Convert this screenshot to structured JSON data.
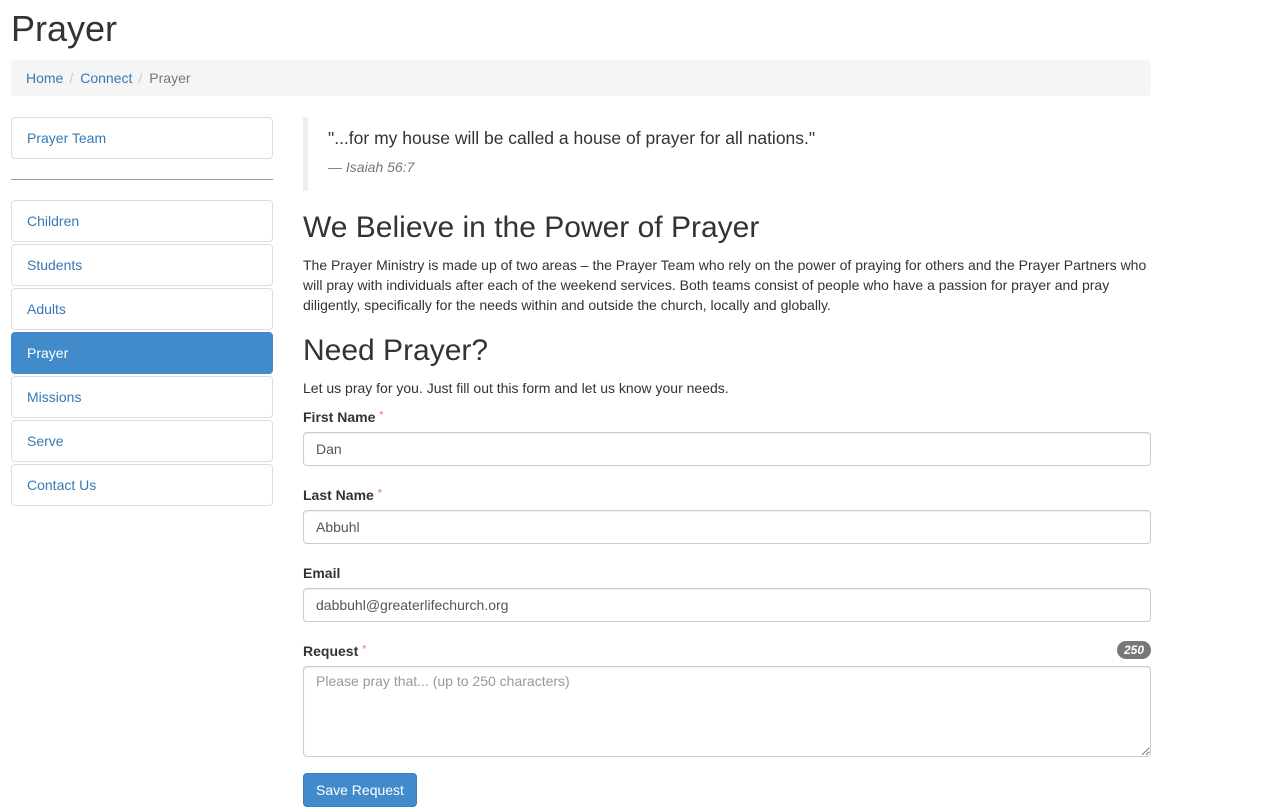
{
  "page": {
    "title": "Prayer"
  },
  "breadcrumb": {
    "items": [
      "Home",
      "Connect"
    ],
    "current": "Prayer"
  },
  "sidebar": {
    "top_item": "Prayer Team",
    "items": [
      "Children",
      "Students",
      "Adults",
      "Prayer",
      "Missions",
      "Serve",
      "Contact Us"
    ],
    "active": "Prayer"
  },
  "quote": {
    "text": "\"...for my house will be called a house of prayer for all nations.\"",
    "citation": "— Isaiah 56:7"
  },
  "believe": {
    "heading": "We Believe in the Power of Prayer",
    "body": "The Prayer Ministry is made up of two areas – the Prayer Team who rely on the power of praying for others and the Prayer Partners who will pray with individuals after each of the weekend services. Both teams consist of people who have a passion for prayer and pray diligently, specifically for the needs within and outside the church, locally and globally."
  },
  "need": {
    "heading": "Need Prayer?",
    "intro": "Let us pray for you. Just fill out this form and let us know your needs."
  },
  "form": {
    "required_marker": "*",
    "first_name": {
      "label": "First Name",
      "value": "Dan"
    },
    "last_name": {
      "label": "Last Name",
      "value": "Abbuhl"
    },
    "email": {
      "label": "Email",
      "value": "dabbuhl@greaterlifechurch.org"
    },
    "request": {
      "label": "Request",
      "placeholder": "Please pray that... (up to 250 characters)",
      "counter": "250"
    },
    "submit_label": "Save Request"
  },
  "colors": {
    "link": "#337ab7",
    "primary": "#428bca",
    "required": "#e9967a"
  }
}
